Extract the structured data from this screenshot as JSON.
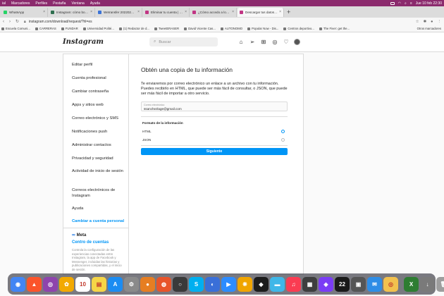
{
  "menubar": {
    "items": [
      "ial",
      "Marcadores",
      "Perfiles",
      "Pestaña",
      "Ventana",
      "Ayuda"
    ],
    "clock": "Jue 10 feb  22:30"
  },
  "tabs": [
    {
      "label": "WhatsApp",
      "color": "#25d366"
    },
    {
      "label": "Instagram: cómo borrar o eliminar",
      "color": "#2f6f4f"
    },
    {
      "label": "Wetransfer 20220209 - Documen...",
      "color": "#3b73d6"
    },
    {
      "label": "Eliminar tu cuenta | Servicio de ay...",
      "color": "#c13584"
    },
    {
      "label": "¿Cómo accedo a los datos de Inst...",
      "color": "#c13584"
    },
    {
      "label": "Descargar tus datos · Instagram",
      "color": "#c13584",
      "active": true
    }
  ],
  "addressbar": {
    "url": "instagram.com/download/request/?hl=es"
  },
  "bookmarks": [
    "Escuela Comuni...",
    "CARRERAS",
    "FUNDAR",
    "Universidad Polité...",
    "(1) Redactor de d...",
    "TweetERASER",
    "David Vicente Cas...",
    "AUTONOMO",
    "Popular Now - Dis...",
    "Centros deportivo...",
    "The Fiver: get the..."
  ],
  "bookmarks_other": "Otros marcadores",
  "header": {
    "logo": "Instagram",
    "search_placeholder": "Buscar"
  },
  "sidebar": {
    "items": [
      "Editar perfil",
      "Cuenta profesional",
      "Cambiar contraseña",
      "Apps y sitios web",
      "Correo electrónico y SMS",
      "Notificaciones push",
      "Administrar contactos",
      "Privacidad y seguridad",
      "Actividad de inicio de sesión",
      "Correos electrónicos de Instagram",
      "Ayuda"
    ],
    "switch_account": "Cambiar a cuenta personal",
    "meta_logo": "Meta",
    "meta_center": "Centro de cuentas",
    "meta_desc": "Controla la configuración de las experiencias conectadas entre Instagram, la app de Facebook y Messenger, incluidas las historias y publicaciones compartidas, y el inicio de sesión."
  },
  "main": {
    "title": "Obtén una copia de tu información",
    "description": "Te enviaremos por correo electrónico un enlace a un archivo con tu información. Puedes recibirlo en HTML, que puede ser más fácil de consultar, o JSON, que puede ser más fácil de importar a otro servicio.",
    "email_label": "Correo electrónico",
    "email_value": "ssanchezlage@gmail.com",
    "format_title": "Formato de la información",
    "format_options": [
      "HTML",
      "JSON"
    ],
    "format_selected": "HTML",
    "next_button": "Siguiente"
  },
  "dock": {
    "apps": [
      {
        "name": "chrome",
        "glyph": "◉",
        "color": "#4285f4"
      },
      {
        "name": "brave",
        "glyph": "▲",
        "color": "#fb542b"
      },
      {
        "name": "podcasts",
        "glyph": "◎",
        "color": "#8e44ad"
      },
      {
        "name": "photos",
        "glyph": "✿",
        "color": "#f2a900"
      },
      {
        "name": "calendar",
        "glyph": "10",
        "color": "#ffffff"
      },
      {
        "name": "notes",
        "glyph": "▤",
        "color": "#f5d547"
      },
      {
        "name": "app-store",
        "glyph": "A",
        "color": "#1b8cf2"
      },
      {
        "name": "system-preferences",
        "glyph": "⚙",
        "color": "#8a8a8a"
      },
      {
        "name": "podcasts-orange",
        "glyph": "●",
        "color": "#e67e22"
      },
      {
        "name": "firefox",
        "glyph": "◍",
        "color": "#e8542a"
      },
      {
        "name": "quicktime",
        "glyph": "○",
        "color": "#3a3a3a"
      },
      {
        "name": "skype",
        "glyph": "S",
        "color": "#00aff0"
      },
      {
        "name": "zoom-like",
        "glyph": "◐",
        "color": "#3a6fd8"
      },
      {
        "name": "zoom",
        "glyph": "▶",
        "color": "#2d8cff"
      },
      {
        "name": "butterfly",
        "glyph": "❋",
        "color": "#f0a500"
      },
      {
        "name": "davinci",
        "glyph": "◆",
        "color": "#1c1c1c"
      },
      {
        "name": "screen-time",
        "glyph": "▬",
        "color": "#3fb7e8"
      },
      {
        "name": "music",
        "glyph": "♫",
        "color": "#fa3c52"
      },
      {
        "name": "calculator",
        "glyph": "▦",
        "color": "#3e3e3e"
      },
      {
        "name": "shortcuts",
        "glyph": "◈",
        "color": "#7a3cf5"
      },
      {
        "name": "counter-22",
        "glyph": "22",
        "color": "#1a1a1a"
      },
      {
        "name": "screenshot",
        "glyph": "▣",
        "color": "#555555"
      },
      {
        "name": "mail",
        "glyph": "✉",
        "color": "#2e8de6"
      },
      {
        "name": "network",
        "glyph": "◎",
        "color": "#f2c14e"
      },
      {
        "name": "folder-excel",
        "glyph": "X",
        "color": "#2e7d32"
      },
      {
        "name": "downloads",
        "glyph": "↓",
        "color": "#7a7a7a"
      },
      {
        "name": "trash",
        "glyph": "🗑",
        "color": "#9e9e9e"
      }
    ]
  }
}
